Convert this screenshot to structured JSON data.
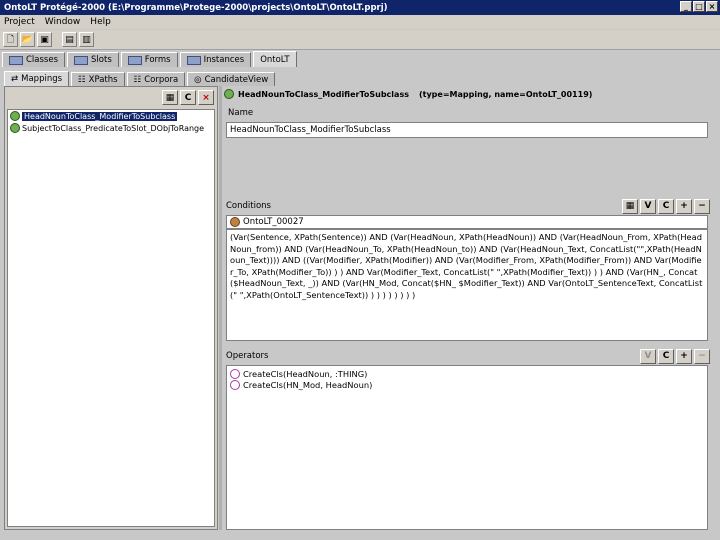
{
  "window": {
    "title": "OntoLT Protégé-2000   (E:\\Programme\\Protege-2000\\projects\\OntoLT\\OntoLT.pprj)",
    "controls": [
      "_",
      "□",
      "×"
    ]
  },
  "menu": [
    "Project",
    "Window",
    "Help"
  ],
  "main_tabs": [
    "Classes",
    "Slots",
    "Forms",
    "Instances",
    "OntoLT"
  ],
  "sub_tabs": [
    "Mappings",
    "XPaths",
    "Corpora",
    "CandidateView"
  ],
  "left": {
    "buttons": [
      "C",
      "×"
    ],
    "items": [
      "HeadNounToClass_ModifierToSubclass",
      "SubjectToClass_PredicateToSlot_DObjToRange"
    ]
  },
  "right": {
    "header_name": "HeadNounToClass_ModifierToSubclass",
    "header_type": "(type=Mapping, name=OntoLT_00119)",
    "name_label": "Name",
    "name_value": "HeadNounToClass_ModifierToSubclass",
    "conditions_label": "Conditions",
    "conditions_buttons": [
      "V",
      "C",
      "+",
      "−"
    ],
    "condition_ref": "OntoLT_00027",
    "condition_text": "(Var(Sentence, XPath(Sentence)) AND (Var(HeadNoun, XPath(HeadNoun)) AND (Var(HeadNoun_From, XPath(HeadNoun_from)) AND (Var(HeadNoun_To, XPath(HeadNoun_to)) AND (Var(HeadNoun_Text, ConcatList(\"\",XPath(HeadNoun_Text)))) AND ((Var(Modifier, XPath(Modifier)) AND (Var(Modifier_From, XPath(Modifier_From)) AND Var(Modifier_To, XPath(Modifier_To)) ) ) AND Var(Modifier_Text, ConcatList(\" \",XPath(Modifier_Text)) ) ) AND (Var(HN_, Concat($HeadNoun_Text, _)) AND (Var(HN_Mod, Concat($HN_ $Modifier_Text)) AND Var(OntoLT_SentenceText, ConcatList(\" \",XPath(OntoLT_SentenceText)) ) ) ) ) ) ) ) )",
    "operators_label": "Operators",
    "operators_buttons": [
      "V",
      "C",
      "+",
      "−"
    ],
    "operators": [
      "CreateCls(HeadNoun, :THING)",
      "CreateCls(HN_Mod, HeadNoun)"
    ]
  }
}
